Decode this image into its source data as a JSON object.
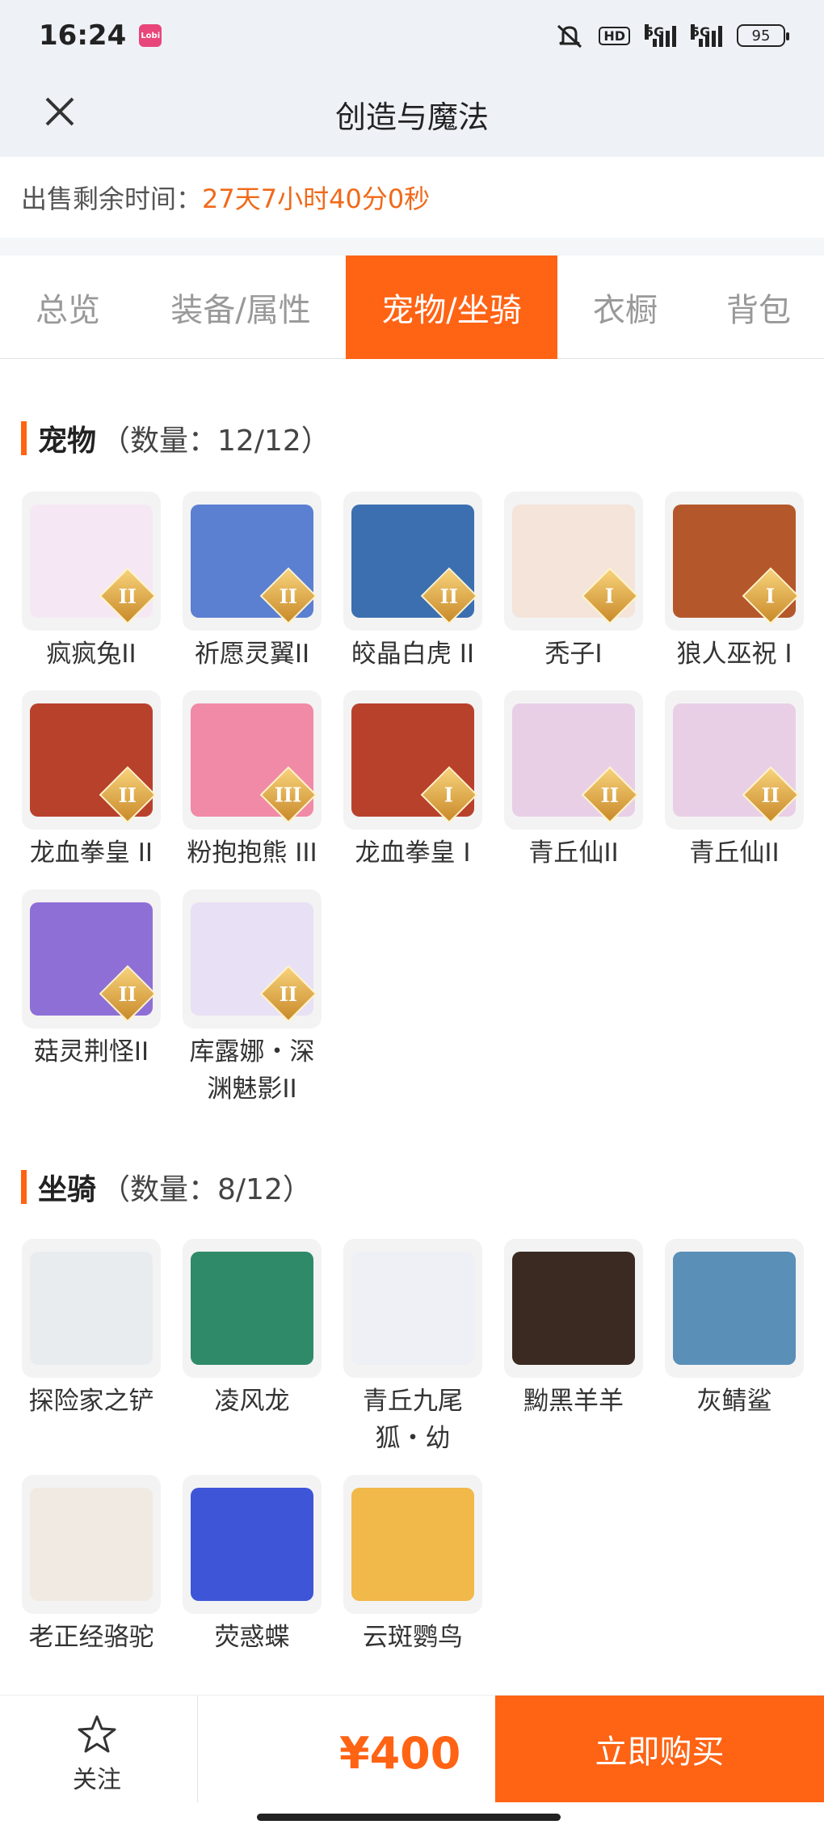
{
  "status_bar": {
    "time": "16:24",
    "app_badge": "Lobi",
    "hd": "HD",
    "net1": "5G",
    "net2": "5G",
    "battery": "95"
  },
  "header": {
    "title": "创造与魔法"
  },
  "countdown": {
    "label": "出售剩余时间：",
    "value": "27天7小时40分0秒"
  },
  "tabs": [
    {
      "label": "总览",
      "active": false
    },
    {
      "label": "装备/属性",
      "active": false
    },
    {
      "label": "宠物/坐骑",
      "active": true
    },
    {
      "label": "衣橱",
      "active": false
    },
    {
      "label": "背包",
      "active": false
    }
  ],
  "pets": {
    "title": "宠物",
    "count": "（数量：12/12）",
    "items": [
      {
        "name": "疯疯兔II",
        "rank": "II",
        "color": "#f5e8f4"
      },
      {
        "name": "祈愿灵翼II",
        "rank": "II",
        "color": "#5b7fd1"
      },
      {
        "name": "皎晶白虎 II",
        "rank": "II",
        "color": "#3b6fb0"
      },
      {
        "name": "秃子I",
        "rank": "I",
        "color": "#f4e4da"
      },
      {
        "name": "狼人巫祝 I",
        "rank": "I",
        "color": "#b4582c"
      },
      {
        "name": "龙血拳皇 II",
        "rank": "II",
        "color": "#b8412c"
      },
      {
        "name": "粉抱抱熊 III",
        "rank": "III",
        "color": "#f08aa6"
      },
      {
        "name": "龙血拳皇 I",
        "rank": "I",
        "color": "#b8412c"
      },
      {
        "name": "青丘仙II",
        "rank": "II",
        "color": "#e8cfe6"
      },
      {
        "name": "青丘仙II",
        "rank": "II",
        "color": "#e8cfe6"
      },
      {
        "name": "菇灵荆怪II",
        "rank": "II",
        "color": "#8e6fd6"
      },
      {
        "name": "库露娜・深渊魅影II",
        "rank": "II",
        "color": "#e8e0f4"
      }
    ]
  },
  "mounts": {
    "title": "坐骑",
    "count": "（数量：8/12）",
    "items": [
      {
        "name": "探险家之铲",
        "color": "#e9ecef"
      },
      {
        "name": "凌风龙",
        "color": "#2f8a6a"
      },
      {
        "name": "青丘九尾狐・幼",
        "color": "#eef0f6"
      },
      {
        "name": "黝黑羊羊",
        "color": "#3a2a22"
      },
      {
        "name": "灰鲭鲨",
        "color": "#5a8fb8"
      },
      {
        "name": "老正经骆驼",
        "color": "#f0eae2"
      },
      {
        "name": "荧惑蝶",
        "color": "#3e55d8"
      },
      {
        "name": "云斑鹦鸟",
        "color": "#f1b84a"
      }
    ]
  },
  "bottom": {
    "follow_label": "关注",
    "price": "¥400",
    "buy_label": "立即购买"
  }
}
